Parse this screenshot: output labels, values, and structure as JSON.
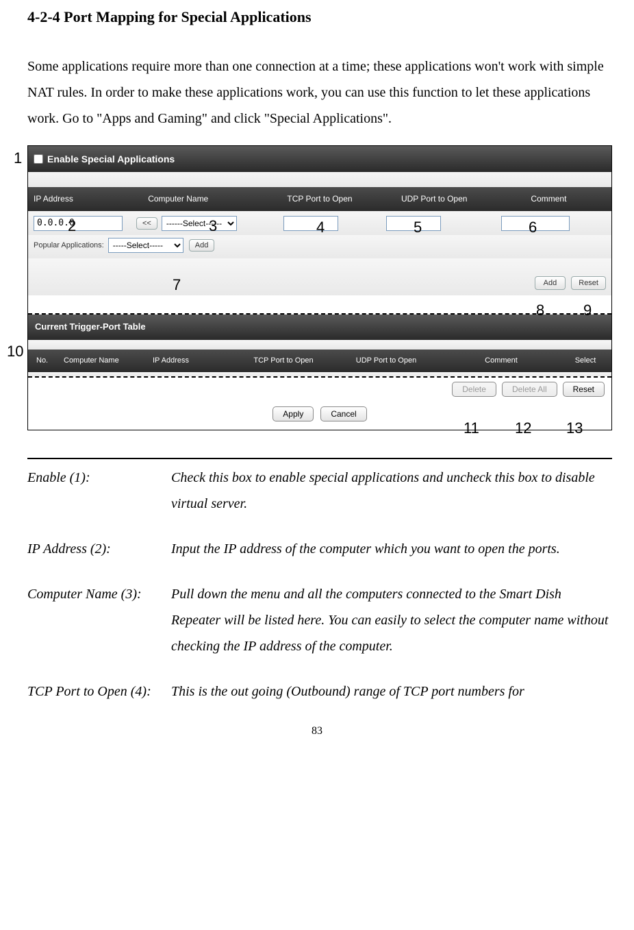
{
  "heading": "4-2-4 Port Mapping for Special Applications",
  "intro": "Some applications require more than one connection at a time; these applications won't work with simple NAT rules. In order to make these applications work, you can use this function to let these applications work. Go to \"Apps and Gaming\" and click \"Special Applications\".",
  "panel": {
    "enable_label": "Enable Special Applications",
    "headers": {
      "ip": "IP Address",
      "computer": "Computer Name",
      "tcp": "TCP Port to Open",
      "udp": "UDP Port to Open",
      "comment": "Comment"
    },
    "ip_value": "0.0.0.0",
    "assign_btn": "<<",
    "select_placeholder": "------Select------",
    "popular_label": "Popular Applications:",
    "popular_select": "-----Select-----",
    "add_small": "Add",
    "add_btn": "Add",
    "reset_btn": "Reset",
    "trigger_title": "Current Trigger-Port Table",
    "table_headers": {
      "no": "No.",
      "computer": "Computer Name",
      "ip": "IP Address",
      "tcp": "TCP Port to Open",
      "udp": "UDP Port to Open",
      "comment": "Comment",
      "select": "Select"
    },
    "delete_btn": "Delete",
    "delete_all_btn": "Delete All",
    "reset2_btn": "Reset",
    "apply_btn": "Apply",
    "cancel_btn": "Cancel"
  },
  "callouts": {
    "c1": "1",
    "c2": "2",
    "c3": "3",
    "c4": "4",
    "c5": "5",
    "c6": "6",
    "c7": "7",
    "c8": "8",
    "c9": "9",
    "c10": "10",
    "c11": "11",
    "c12": "12",
    "c13": "13"
  },
  "definitions": [
    {
      "term": "Enable (1):",
      "desc": "Check this box to enable special applications and uncheck this box to disable virtual server."
    },
    {
      "term": "IP Address (2):",
      "desc": "Input the IP address of the computer which you want to open the ports."
    },
    {
      "term": "Computer Name (3):",
      "desc": "Pull down the menu and all the computers connected to the Smart Dish Repeater will be listed here. You can easily to select the computer name without checking the IP address of the computer."
    },
    {
      "term": "TCP Port to Open (4):",
      "desc": "This is the out going (Outbound) range of TCP port numbers for"
    }
  ],
  "page_number": "83"
}
